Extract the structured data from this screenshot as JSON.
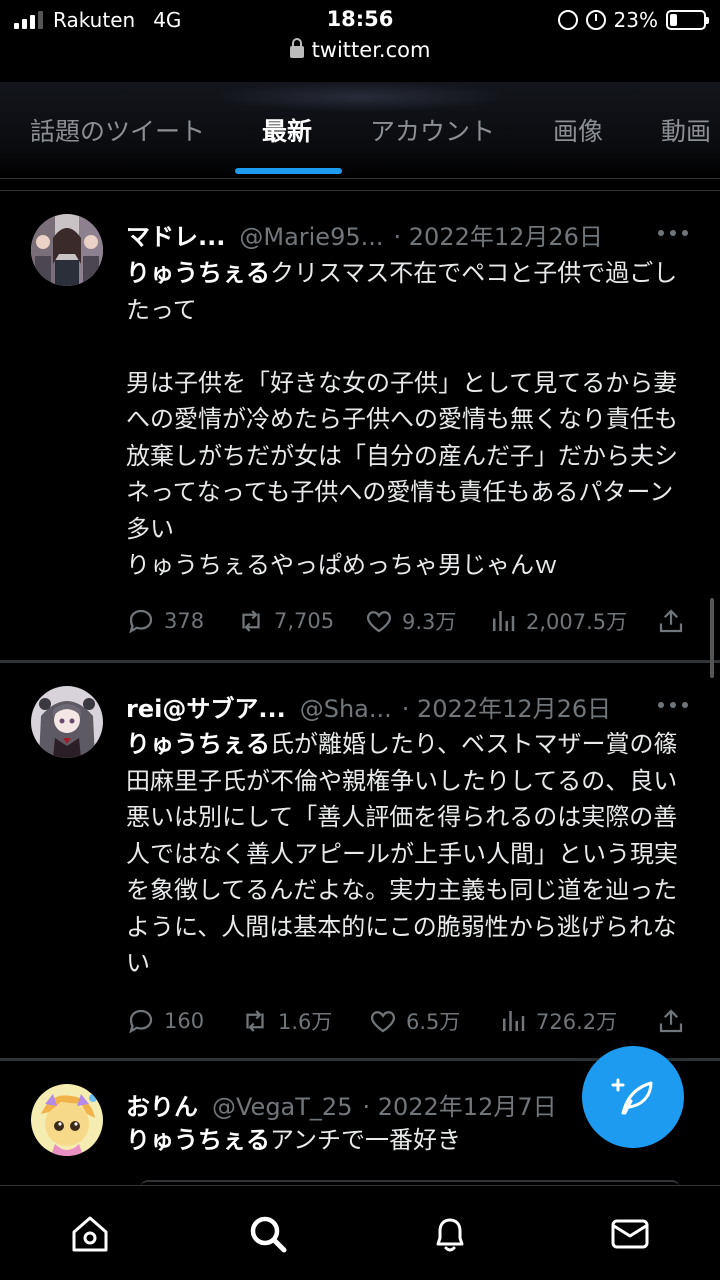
{
  "status_bar": {
    "carrier": "Rakuten",
    "network": "4G",
    "time": "18:56",
    "battery": "23%",
    "battery_level": 0.23
  },
  "browser": {
    "url": "twitter.com"
  },
  "tabs": [
    {
      "label": "話題のツイート",
      "active": false
    },
    {
      "label": "最新",
      "active": true
    },
    {
      "label": "アカウント",
      "active": false
    },
    {
      "label": "画像",
      "active": false
    },
    {
      "label": "動画",
      "active": false
    }
  ],
  "tweets": [
    {
      "name": "マドレ...",
      "handle": "@Marie95...",
      "date": "· 2022年12月26日",
      "mention": "りゅうちぇる",
      "body": "クリスマス不在でペコと子供で過ごしたって\n\n男は子供を「好きな女の子供」として見てるから妻への愛情が冷めたら子供への愛情も無くなり責任も放棄しがちだが女は「自分の産んだ子」だから夫シネってなっても子供への愛情も責任もあるパターン多い\nりゅうちぇるやっぱめっちゃ男じゃんｗ",
      "replies": "378",
      "retweets": "7,705",
      "likes": "9.3万",
      "views": "2,007.5万"
    },
    {
      "name": "rei@サブア...",
      "handle": "@Sha...",
      "date": "· 2022年12月26日",
      "mention": "りゅうちぇる",
      "body": "氏が離婚したり、ベストマザー賞の篠田麻里子氏が不倫や親権争いしたりしてるの、良い悪いは別にして「善人評価を得られるのは実際の善人ではなく善人アピールが上手い人間」という現実を象徴してるんだよな。実力主義も同じ道を辿ったように、人間は基本的にこの脆弱性から逃げられない",
      "replies": "160",
      "retweets": "1.6万",
      "likes": "6.5万",
      "views": "726.2万"
    },
    {
      "name": "おりん",
      "handle": "@VegaT_25",
      "date": "· 2022年12月7日",
      "mention": "りゅうちぇる",
      "body": "アンチで一番好き"
    }
  ],
  "colors": {
    "accent": "#1d9bf0",
    "muted": "#71767b",
    "background": "#000000"
  },
  "icons": {
    "fab": "compose-feather-plus-icon",
    "nav": [
      "home-icon",
      "search-icon",
      "notifications-bell-icon",
      "messages-envelope-icon"
    ]
  }
}
